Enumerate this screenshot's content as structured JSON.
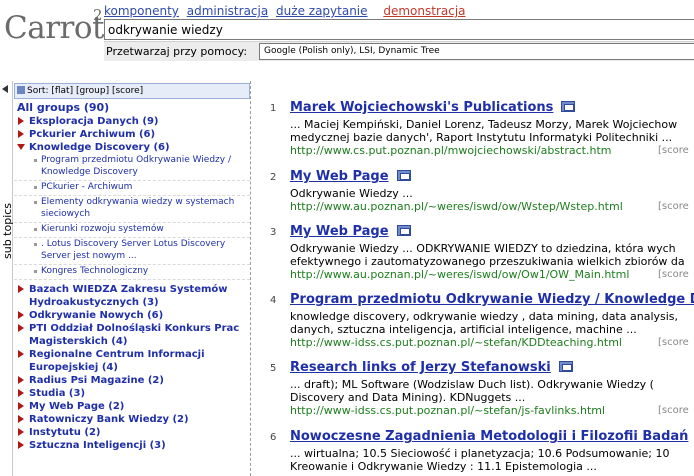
{
  "header": {
    "logo_text": "Carrot",
    "logo_sup": "2",
    "nav": [
      "komponenty",
      "administracja",
      "duże zapytanie",
      "demonstracja"
    ],
    "query_value": "odkrywanie wiedzy",
    "processing_label": "Przetwarzaj przy pomocy:",
    "processing_value": "Google (Polish only), LSI, Dynamic Tree"
  },
  "sidebar": {
    "tab_label": "sub topics",
    "sort_text": "Sort: [flat] [group] [score]",
    "all_groups": "All groups (90)",
    "groups_before": [
      "Eksploracja Danych (9)",
      "Pckurier Archiwum (6)"
    ],
    "open_group": "Knowledge Discovery (6)",
    "children": [
      "Program przedmiotu Odkrywanie Wiedzy / Knowledge Discovery",
      "PCkurier - Archiwum",
      "Elementy odkrywania wiedzy w systemach sieciowych",
      "Kierunki rozwoju systemów",
      ". Lotus Discovery Server Lotus Discovery Server jest nowym ...",
      "Kongres Technologiczny"
    ],
    "groups_after": [
      "Bazach WIEDZA Zakresu Systemów Hydroakustycznych (3)",
      "Odkrywanie Nowych (6)",
      "PTI Oddział Dolnośląski Konkurs Prac Magisterskich (4)",
      "Regionalne Centrum Informacji Europejskiej (4)",
      "Radius Psi Magazine (2)",
      "Studia (3)",
      "My Web Page (2)",
      "Ratowniczy Bank Wiedzy (2)",
      "Instytutu (2)",
      "Sztuczna Inteligencji (3)"
    ]
  },
  "results": [
    {
      "num": "1",
      "title": "Marek Wojciechowski's Publications",
      "snippet": [
        "... Maciej Kempiński, Daniel Lorenz, Tadeusz Morzy, Marek Wojciechow",
        "medycznej bazie danych', Raport Instytutu Informatyki Politechniki ..."
      ],
      "url": "http://www.cs.put.poznan.pl/mwojciechowski/abstract.htm",
      "score": "[score"
    },
    {
      "num": "2",
      "title": "My Web Page",
      "snippet": [
        "Odkrywanie Wiedzy ..."
      ],
      "url": "http://www.au.poznan.pl/~weres/iswd/ow/Wstep/Wstep.html",
      "score": "[score"
    },
    {
      "num": "3",
      "title": "My Web Page",
      "snippet": [
        "Odkrywanie Wiedzy ... ODKRYWANIE WIEDZY to dziedzina, która wych",
        "efektywnego i zautomatyzowanego przeszukiwania wielkich zbiorów da"
      ],
      "url": "http://www.au.poznan.pl/~weres/iswd/ow/Ow1/OW_Main.html",
      "score": "[score"
    },
    {
      "num": "4",
      "title": "Program przedmiotu Odkrywanie Wiedzy / Knowledge D",
      "snippet": [
        "knowledge discovery, odkrywanie wiedzy , data mining, data analysis,",
        "danych, sztuczna inteligencja, artificial inteligence, machine ..."
      ],
      "url": "http://www-idss.cs.put.poznan.pl/~stefan/KDDteaching.html",
      "score": "[score"
    },
    {
      "num": "5",
      "title": "Research links of Jerzy Stefanowski",
      "snippet": [
        "... draft); ML Software (Wodzislaw Duch list). Odkrywanie Wiedzy (",
        "Discovery and Data Mining). KDNuggets ..."
      ],
      "url": "http://www-idss.cs.put.poznan.pl/~stefan/js-favlinks.html",
      "score": "[score"
    },
    {
      "num": "6",
      "title": "Nowoczesne Zagadnienia Metodologii i Filozofii Badań",
      "snippet": [
        "... wirtualna; 10.5 Sieciowość i planetyzacja; 10.6 Podsumowanie; 10",
        "Kreowanie i Odkrywanie Wiedzy : 11.1 Epistemologia ..."
      ],
      "url": "",
      "score": ""
    }
  ]
}
